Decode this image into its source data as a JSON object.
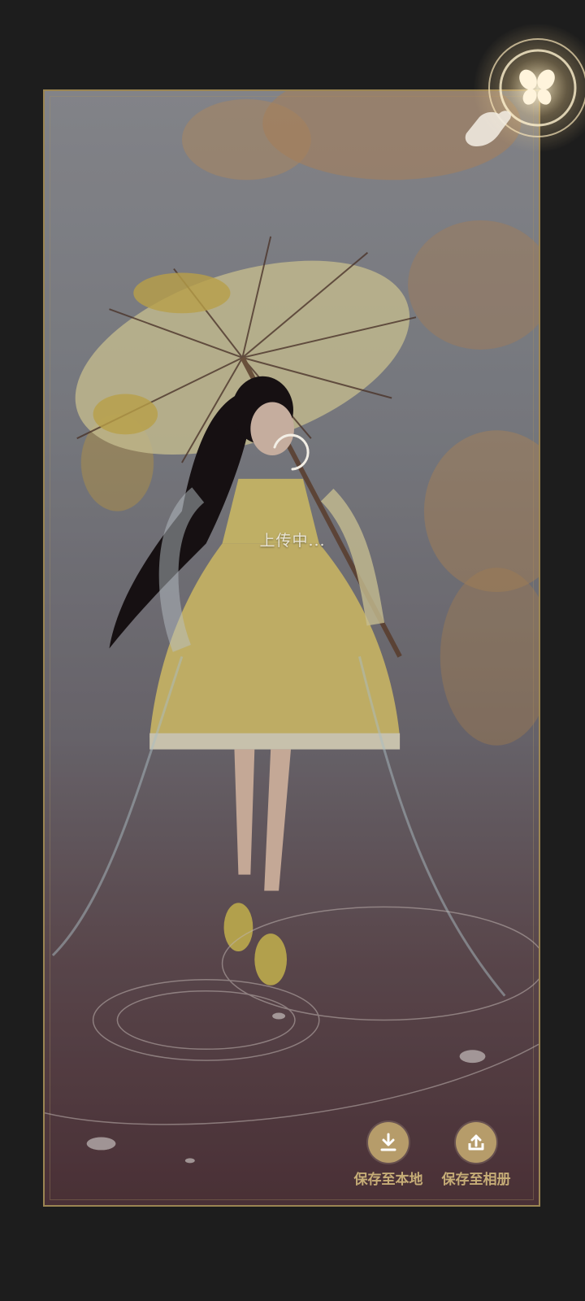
{
  "status": {
    "uploading_text": "上传中..."
  },
  "actions": {
    "save_local_label": "保存至本地",
    "save_album_label": "保存至相册"
  },
  "icons": {
    "spinner": "loading-spinner-icon",
    "download": "download-icon",
    "upload": "upload-share-icon",
    "guide": "tap-hand-guide-icon",
    "butterfly": "butterfly-icon"
  },
  "colors": {
    "background": "#1d1d1d",
    "frame_border": "#9b8552",
    "button_gold": "#b69c6a",
    "label_gold": "#c6ad77",
    "dress_yellow": "#e8d27a"
  }
}
